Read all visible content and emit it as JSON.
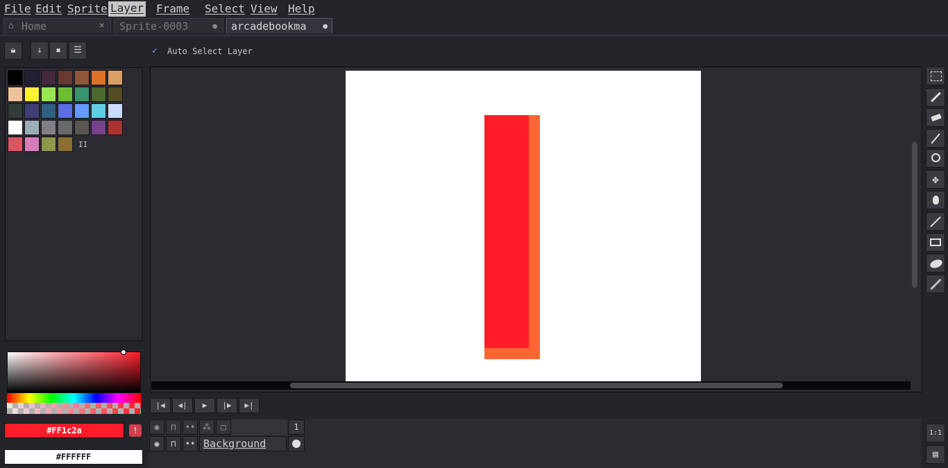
{
  "menu": [
    "File",
    "Edit",
    "Sprite",
    "Layer",
    "Frame",
    "Select",
    "View",
    "Help"
  ],
  "active_menu": "Layer",
  "tabs": [
    {
      "label": "Home",
      "icon": "home-icon",
      "control": "×"
    },
    {
      "label": "Sprite-0003",
      "control": "●"
    },
    {
      "label": "arcadebookma",
      "control": "●"
    }
  ],
  "toolbar": {
    "auto_select_label": "Auto Select Layer",
    "auto_select_checked": true
  },
  "palette": {
    "colors": [
      "#000000",
      "#222034",
      "#45283c",
      "#663931",
      "#8f563b",
      "#df7126",
      "#d9a066",
      "#eec39a",
      "#fbf236",
      "#99e550",
      "#6abe30",
      "#37946e",
      "#4b692f",
      "#524b24",
      "#323c39",
      "#3f3f74",
      "#306082",
      "#5b6ee1",
      "#639bff",
      "#5fcde4",
      "#cbdbfc",
      "#ffffff",
      "#9badb7",
      "#847e87",
      "#696a6a",
      "#595652",
      "#76428a",
      "#ac3232",
      "#d95763",
      "#d77bba",
      "#8f974a",
      "#8a6f30"
    ],
    "more_icon": "II"
  },
  "colors": {
    "foreground": "#FF1c2a",
    "background": "#FFFFFF",
    "fg_hex": "#ff1c2a",
    "bg_hex": "#ffffff"
  },
  "canvas": {
    "rect1_color": "#ff1c2a",
    "rect2_color": "#ff6532"
  },
  "timeline": {
    "frame_number": "1",
    "layer_name": "Background"
  },
  "zoom_button": "1:1"
}
